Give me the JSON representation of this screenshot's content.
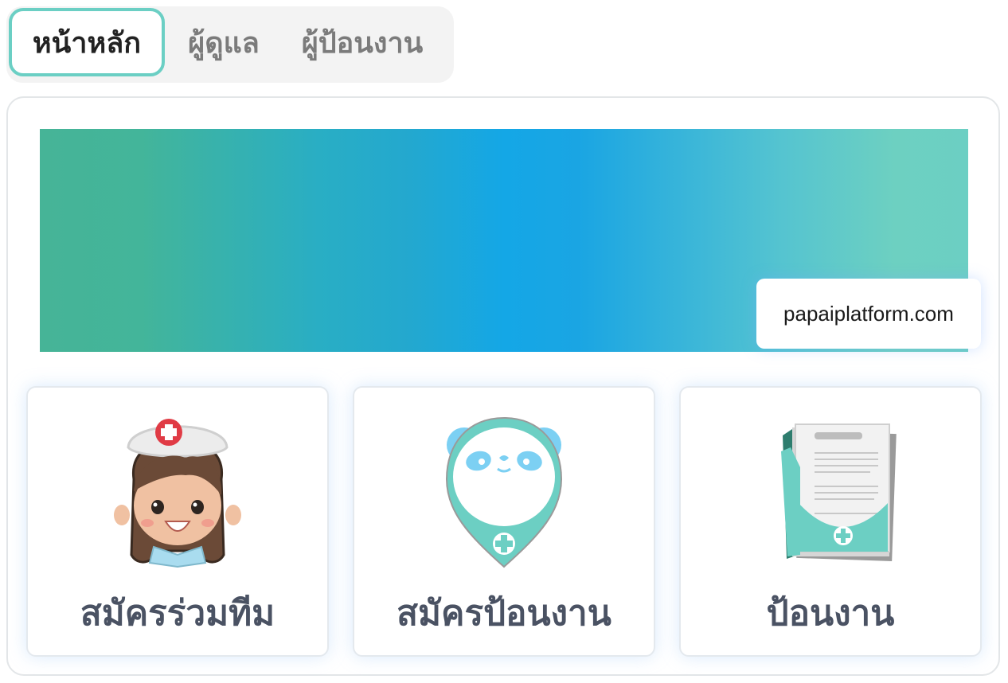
{
  "tabs": [
    {
      "label": "หน้าหลัก",
      "active": true
    },
    {
      "label": "ผู้ดูแล",
      "active": false
    },
    {
      "label": "ผู้ป้อนงาน",
      "active": false
    }
  ],
  "banner": {
    "site": "papaiplatform.com"
  },
  "cards": [
    {
      "label": "สมัครร่วมทีม",
      "icon": "nurse-icon"
    },
    {
      "label": "สมัครป้อนงาน",
      "icon": "panda-pin-icon"
    },
    {
      "label": "ป้อนงาน",
      "icon": "documents-icon"
    }
  ],
  "colors": {
    "accent": "#6bcfc4",
    "label_text": "#4a5263",
    "banner_start": "#46b497",
    "banner_mid": "#14a7e6",
    "banner_end": "#6ccfc3"
  }
}
